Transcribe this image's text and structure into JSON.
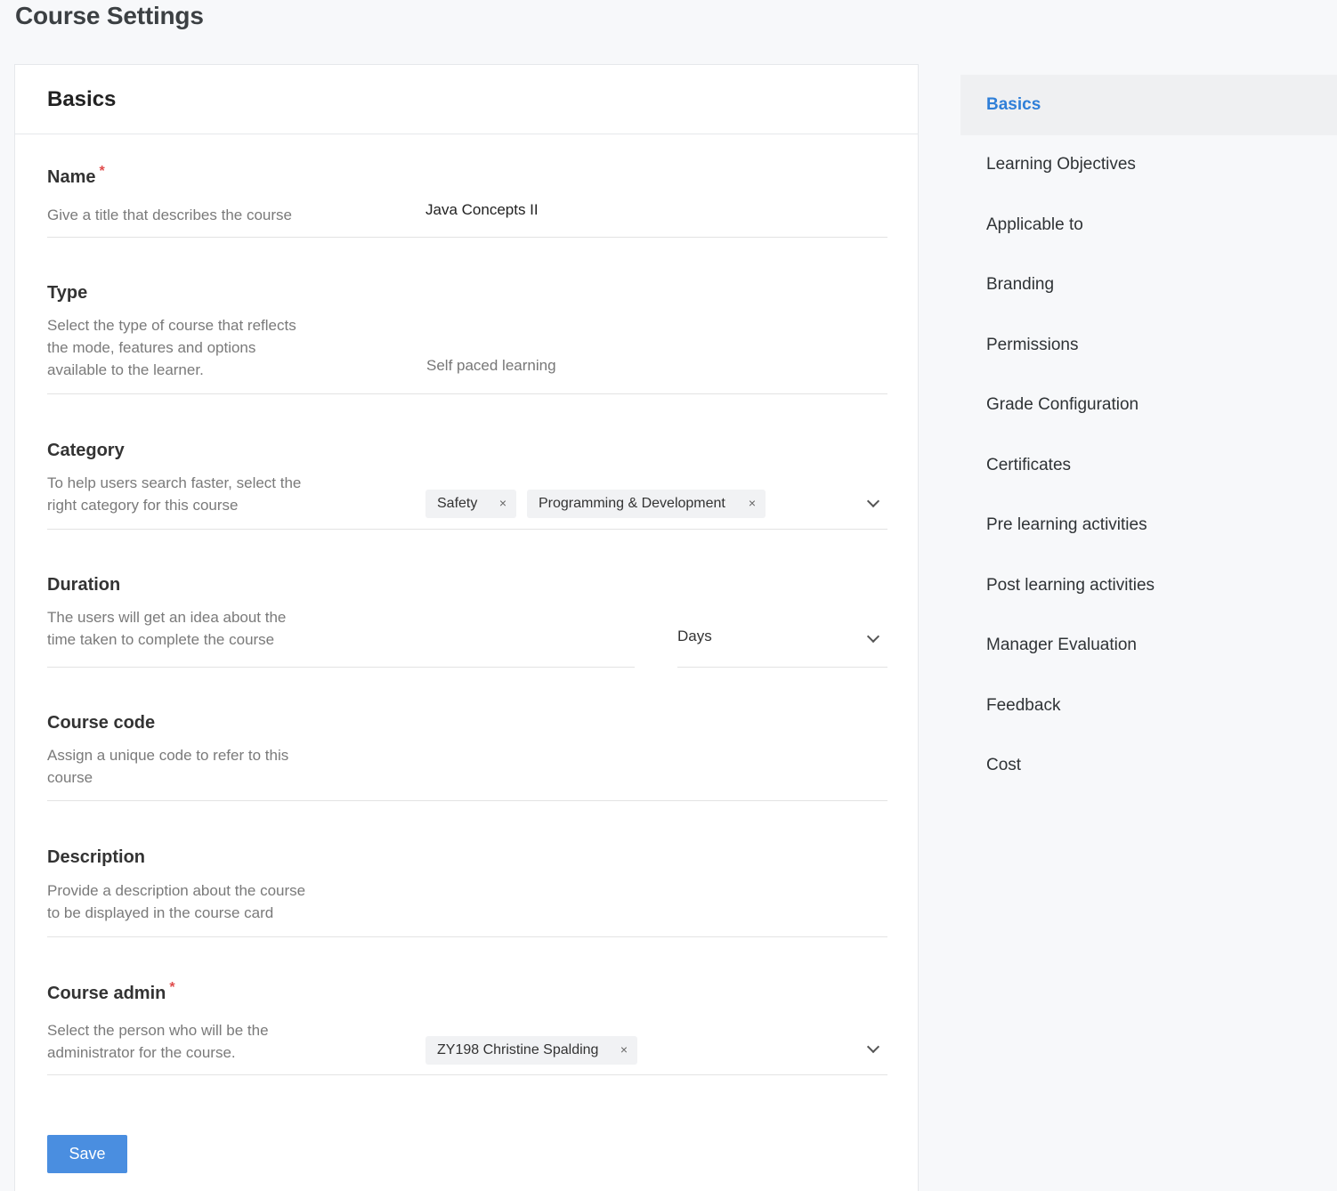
{
  "page": {
    "title": "Course Settings"
  },
  "section": {
    "title": "Basics"
  },
  "fields": {
    "name": {
      "label": "Name",
      "required_mark": "*",
      "description": "Give a title that describes the course",
      "value": "Java Concepts II"
    },
    "type": {
      "label": "Type",
      "description": "Select the type of course that reflects the mode, features and options available to the learner.",
      "value": "Self paced learning"
    },
    "category": {
      "label": "Category",
      "description": "To help users search faster, select the right category for this course",
      "chips": [
        "Safety",
        "Programming & Development"
      ],
      "chip_remove": "×"
    },
    "duration": {
      "label": "Duration",
      "description": "The users will get an idea about the time taken to complete the course",
      "unit": "Days"
    },
    "course_code": {
      "label": "Course code",
      "description": "Assign a unique code to refer to this course"
    },
    "description": {
      "label": "Description",
      "description": "Provide a description about the course to be displayed in the course card"
    },
    "course_admin": {
      "label": "Course admin",
      "required_mark": "*",
      "description": "Select the person who will be the administrator for the course.",
      "chips": [
        "ZY198 Christine Spalding"
      ],
      "chip_remove": "×"
    }
  },
  "actions": {
    "save_label": "Save"
  },
  "sidenav": {
    "active_index": 0,
    "items": [
      "Basics",
      "Learning Objectives",
      "Applicable to",
      "Branding",
      "Permissions",
      "Grade Configuration",
      "Certificates",
      "Pre learning activities",
      "Post learning activities",
      "Manager Evaluation",
      "Feedback",
      "Cost"
    ]
  },
  "colors": {
    "accent": "#2f7fd8",
    "button": "#4a8ee0",
    "required": "#e04b4b"
  }
}
